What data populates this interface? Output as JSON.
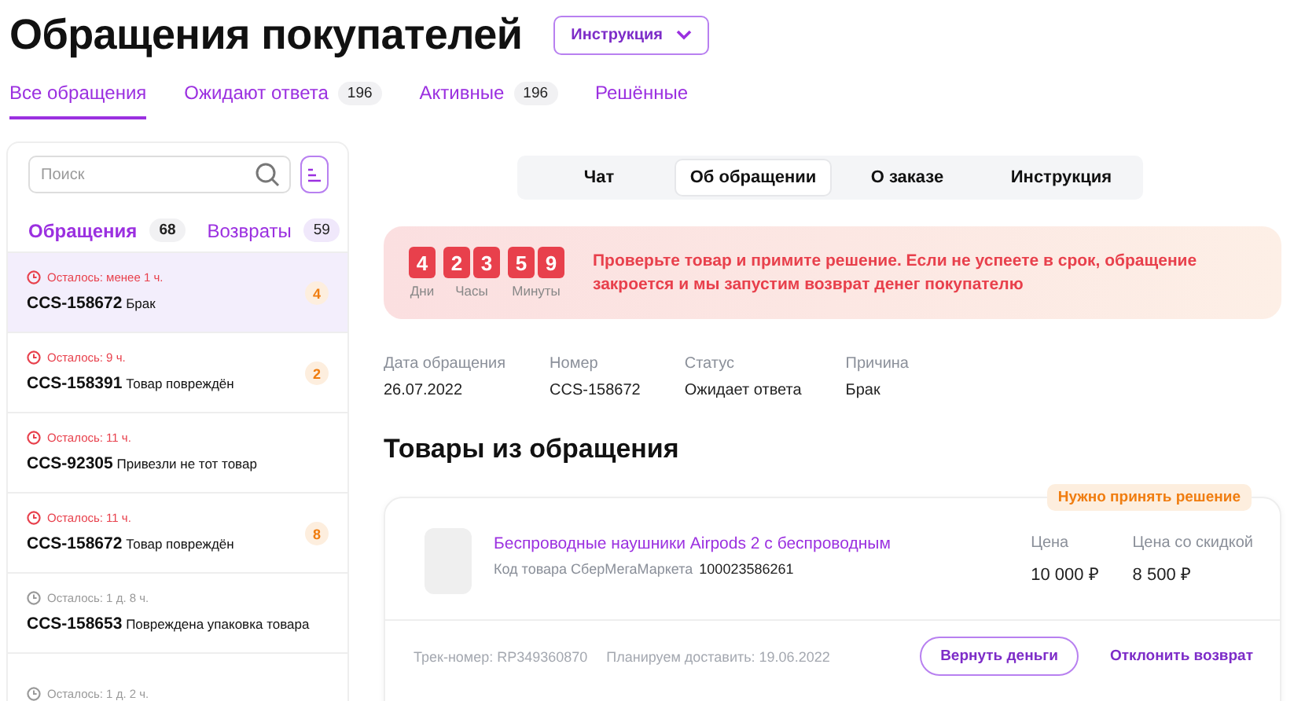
{
  "header": {
    "title": "Обращения покупателей",
    "menu_button": "Инструкция"
  },
  "tabs": [
    {
      "label": "Все обращения",
      "selected": true
    },
    {
      "label": "Ожидают ответа",
      "count": "196",
      "selected": false
    },
    {
      "label": "Активные",
      "count": "196",
      "selected": false
    },
    {
      "label": "Решённые",
      "selected": false
    }
  ],
  "sidebar": {
    "search": {
      "placeholder": "Поиск"
    },
    "subtabs": [
      {
        "label": "Обращения",
        "count": "68",
        "selected": true
      },
      {
        "label": "Возвраты",
        "count": "59",
        "selected": false
      }
    ],
    "items": [
      {
        "time": "Осталось: менее 1 ч.",
        "urgent": true,
        "number": "CCS-158672",
        "reason": "Брак",
        "badge": "4",
        "selected": true
      },
      {
        "time": "Осталось: 9 ч.",
        "urgent": true,
        "number": "CCS-158391",
        "reason": "Товар повреждён",
        "badge": "2",
        "selected": false
      },
      {
        "time": "Осталось: 11 ч.",
        "urgent": true,
        "number": "CCS-92305",
        "reason": "Привезли не тот товар",
        "selected": false
      },
      {
        "time": "Осталось: 11 ч.",
        "urgent": true,
        "number": "CCS-158672",
        "reason": "Товар повреждён",
        "badge": "8",
        "selected": false
      },
      {
        "time": "Осталось: 1 д. 8 ч.",
        "urgent": false,
        "number": "CCS-158653",
        "reason": "Повреждена упаковка товара",
        "selected": false
      },
      {
        "time": "Осталось: 1 д. 2 ч.",
        "urgent": false,
        "selected": false
      }
    ]
  },
  "detail_tabs": [
    {
      "label": "Чат",
      "selected": false
    },
    {
      "label": "Об обращении",
      "selected": true
    },
    {
      "label": "О заказе",
      "selected": false
    },
    {
      "label": "Инструкция",
      "selected": false
    }
  ],
  "timer": {
    "groups": [
      {
        "digits": [
          "4"
        ],
        "label": "Дни"
      },
      {
        "digits": [
          "2",
          "3"
        ],
        "label": "Часы"
      },
      {
        "digits": [
          "5",
          "9"
        ],
        "label": "Минуты"
      }
    ],
    "message": "Проверьте товар и примите решение. Если не успеете в срок, обращение закроется и мы запустим возврат денег покупателю"
  },
  "info": [
    {
      "label": "Дата обращения",
      "value": "26.07.2022"
    },
    {
      "label": "Номер",
      "value": "CCS-158672"
    },
    {
      "label": "Статус",
      "value": "Ожидает ответа"
    },
    {
      "label": "Причина",
      "value": "Брак"
    }
  ],
  "products_heading": "Товары из обращения",
  "product": {
    "badge": "Нужно принять решение",
    "name": "Беспроводные наушники Airpods 2 с беспроводным",
    "code_label": "Код товара СберМегаМаркета",
    "code": "100023586261",
    "prices": [
      {
        "label": "Цена",
        "value": "10 000 ₽"
      },
      {
        "label": "Цена со скидкой",
        "value": "8 500 ₽"
      }
    ],
    "track": "Трек-номер: RP349360870",
    "delivery": "Планируем доставить: 19.06.2022",
    "refund_button": "Вернуть деньги",
    "reject_link": "Отклонить возврат"
  }
}
